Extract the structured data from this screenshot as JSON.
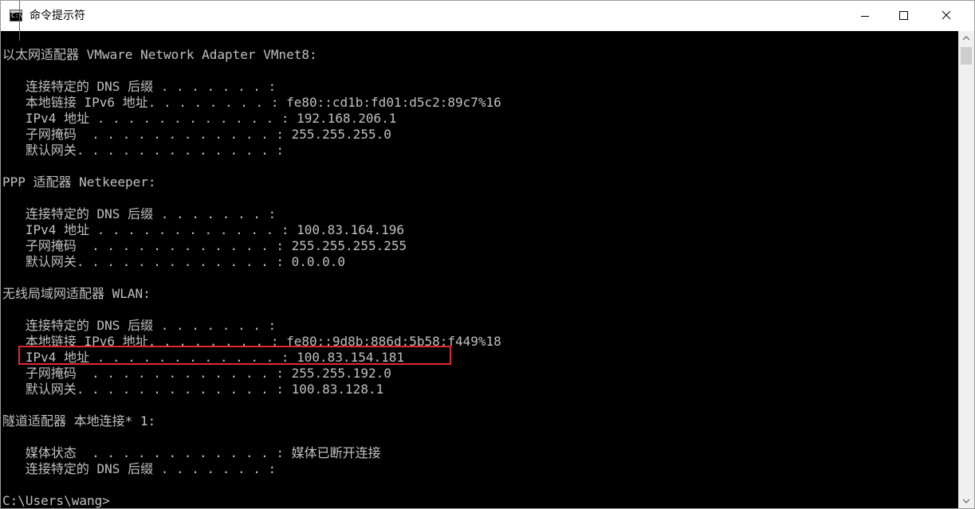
{
  "window": {
    "title": "命令提示符",
    "icon_glyph": "C:\\",
    "controls": [
      "minimize-icon",
      "maximize-icon",
      "close-icon"
    ]
  },
  "console": {
    "lines": [
      "以太网适配器 VMware Network Adapter VMnet8:",
      "",
      "   连接特定的 DNS 后缀 . . . . . . . :",
      "   本地链接 IPv6 地址. . . . . . . . : fe80::cd1b:fd01:d5c2:89c7%16",
      "   IPv4 地址 . . . . . . . . . . . . : 192.168.206.1",
      "   子网掩码  . . . . . . . . . . . . : 255.255.255.0",
      "   默认网关. . . . . . . . . . . . . :",
      "",
      "PPP 适配器 Netkeeper:",
      "",
      "   连接特定的 DNS 后缀 . . . . . . . :",
      "   IPv4 地址 . . . . . . . . . . . . : 100.83.164.196",
      "   子网掩码  . . . . . . . . . . . . : 255.255.255.255",
      "   默认网关. . . . . . . . . . . . . : 0.0.0.0",
      "",
      "无线局域网适配器 WLAN:",
      "",
      "   连接特定的 DNS 后缀 . . . . . . . :",
      "   本地链接 IPv6 地址. . . . . . . . : fe80::9d8b:886d:5b58:f449%18",
      "   IPv4 地址 . . . . . . . . . . . . : 100.83.154.181",
      "   子网掩码  . . . . . . . . . . . . : 255.255.192.0",
      "   默认网关. . . . . . . . . . . . . : 100.83.128.1",
      "",
      "隧道适配器 本地连接* 1:",
      "",
      "   媒体状态  . . . . . . . . . . . . : 媒体已断开连接",
      "   连接特定的 DNS 后缀 . . . . . . . :",
      "",
      "C:\\Users\\wang>"
    ]
  },
  "colors": {
    "console_bg": "#000000",
    "console_text": "#c0c0c0",
    "highlight_border": "#e0292c",
    "titlebar_bg": "#ffffff"
  }
}
